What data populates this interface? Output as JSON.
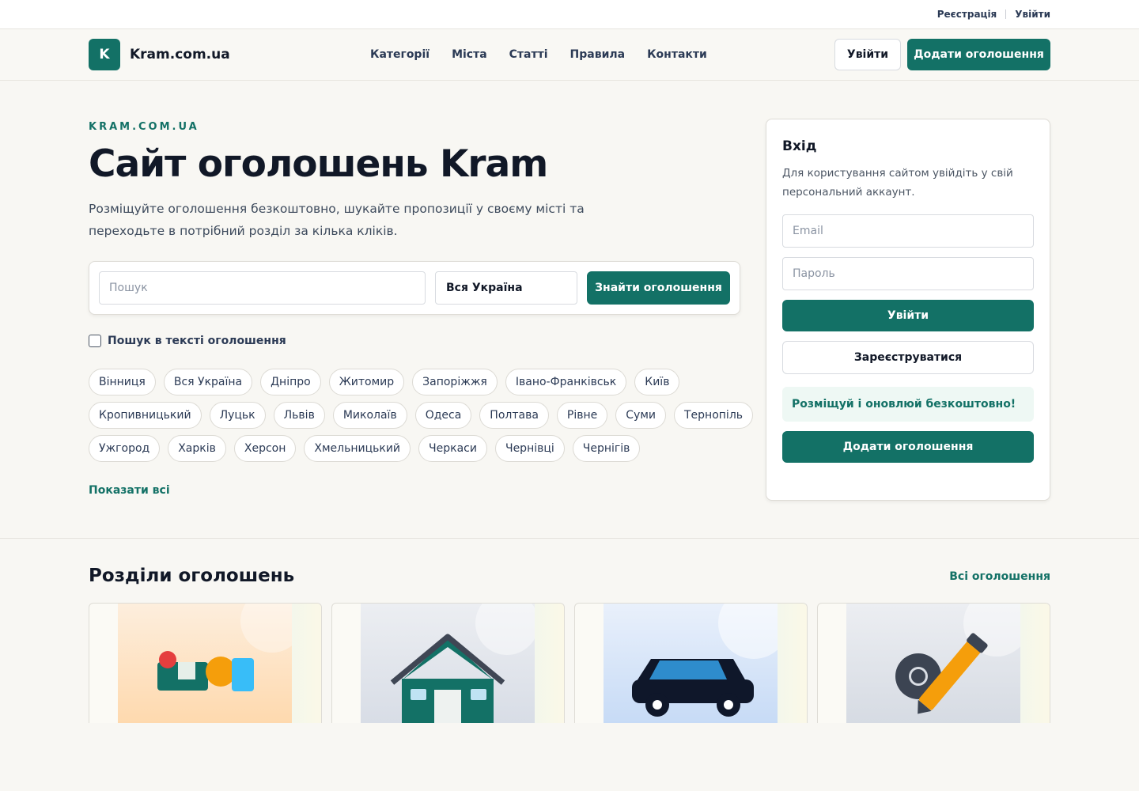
{
  "topbar": {
    "register": "Реєстрація",
    "login": "Увійти"
  },
  "header": {
    "logo_letter": "K",
    "logo_text": "Kram.com.ua",
    "nav": [
      {
        "label": "Категорії"
      },
      {
        "label": "Міста"
      },
      {
        "label": "Статті"
      },
      {
        "label": "Правила"
      },
      {
        "label": "Контакти"
      }
    ],
    "login_button": "Увійти",
    "add_button": "Додати оголошення"
  },
  "hero": {
    "kicker": "KRAM.COM.UA",
    "title": "Сайт оголошень Kram",
    "description": "Розміщуйте оголошення безкоштовно, шукайте пропозиції у своєму місті та переходьте в потрібний розділ за кілька кліків.",
    "search": {
      "placeholder": "Пошук",
      "value": "",
      "region": "Вся Україна",
      "button": "Знайти оголошення"
    },
    "text_search_label": "Пошук в тексті оголошення",
    "text_search_checked": false,
    "cities": [
      [
        "Вінниця",
        "Вся Україна",
        "Дніпро",
        "Житомир",
        "Запоріжжя",
        "Івано-Франківськ",
        "Київ"
      ],
      [
        "Кропивницький",
        "Луцьк",
        "Львів",
        "Миколаїв",
        "Одеса",
        "Полтава",
        "Рівне",
        "Суми",
        "Тернопіль"
      ],
      [
        "Ужгород",
        "Харків",
        "Херсон",
        "Хмельницький",
        "Черкаси",
        "Чернівці",
        "Чернігів"
      ]
    ],
    "show_all": "Показати всі"
  },
  "login_panel": {
    "title": "Вхід",
    "description": "Для користування сайтом увійдіть у свій персональний аккаунт.",
    "email_placeholder": "Email",
    "password_placeholder": "Пароль",
    "submit": "Увійти",
    "register": "Зареєструватися",
    "promo": "Розміщуй і оновлюй безкоштовно!",
    "add_button": "Додати оголошення"
  },
  "sections": {
    "title": "Розділи оголошень",
    "all_link": "Всі оголошення",
    "cards": [
      {
        "icon": "children-goods-icon"
      },
      {
        "icon": "house-icon"
      },
      {
        "icon": "car-icon"
      },
      {
        "icon": "tools-icon"
      }
    ]
  },
  "colors": {
    "brand": "#137166",
    "background": "#f8f7f3",
    "text": "#111827",
    "promo_bg": "#eef8f4"
  }
}
